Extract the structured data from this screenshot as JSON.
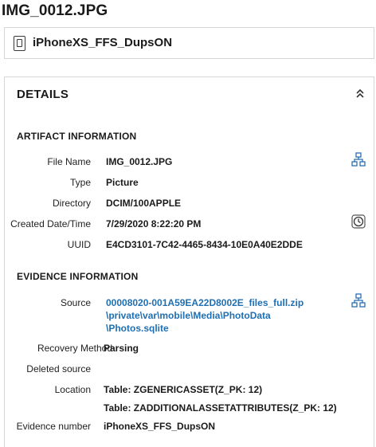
{
  "header": {
    "file_title": "IMG_0012.JPG"
  },
  "device": {
    "name": "iPhoneXS_FFS_DupsON",
    "icon": "phone-icon"
  },
  "details": {
    "title": "DETAILS",
    "collapse_icon": "double-chevron-up-icon",
    "artifact": {
      "title": "ARTIFACT INFORMATION",
      "file_name_label": "File Name",
      "file_name_value": "IMG_0012.JPG",
      "type_label": "Type",
      "type_value": "Picture",
      "directory_label": "Directory",
      "directory_value": "DCIM/100APPLE",
      "created_label": "Created Date/Time",
      "created_value": "7/29/2020 8:22:20 PM",
      "uuid_label": "UUID",
      "uuid_value": "E4CD3101-7C42-4465-8434-10E0A40E2DDE"
    },
    "evidence": {
      "title": "EVIDENCE INFORMATION",
      "source_label": "Source",
      "source_lines": [
        "00008020-001A59EA22D8002E_files_full.zip",
        "\\private\\var\\mobile\\Media\\PhotoData",
        "\\Photos.sqlite"
      ],
      "recovery_label": "Recovery Method",
      "recovery_value": "Parsing",
      "deleted_label": "Deleted source",
      "deleted_value": "",
      "location_label": "Location",
      "location_values": [
        "Table: ZGENERICASSET(Z_PK: 12)",
        "Table: ZADDITIONALASSETATTRIBUTES(Z_PK: 12)"
      ],
      "evidence_number_label": "Evidence number",
      "evidence_number_value": "iPhoneXS_FFS_DupsON"
    }
  },
  "colors": {
    "link": "#1f6fb3",
    "icon_blue": "#2a6fb5",
    "border": "#d6d6d6"
  }
}
